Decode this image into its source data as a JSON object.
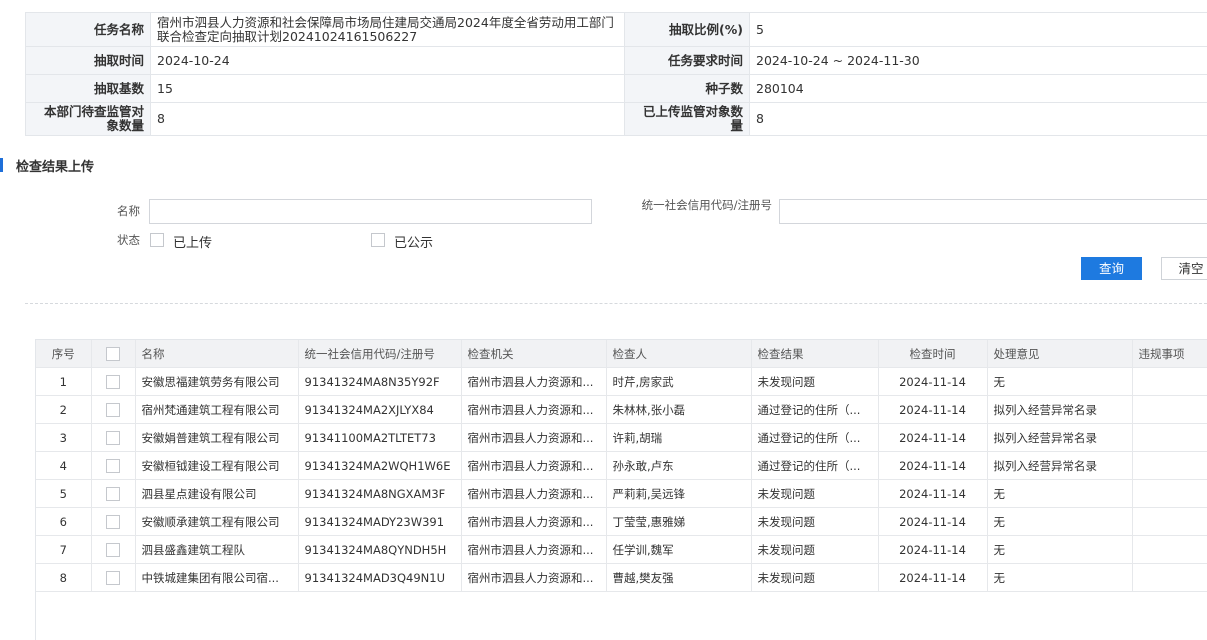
{
  "info": {
    "task_name_label": "任务名称",
    "task_name_value": "宿州市泗县人力资源和社会保障局市场局住建局交通局2024年度全省劳动用工部门联合检查定向抽取计划20241024161506227",
    "ratio_label": "抽取比例(%)",
    "ratio_value": "5",
    "draw_time_label": "抽取时间",
    "draw_time_value": "2024-10-24",
    "required_time_label": "任务要求时间",
    "required_time_value": "2024-10-24 ~ 2024-11-30",
    "base_label": "抽取基数",
    "base_value": "15",
    "seed_label": "种子数",
    "seed_value": "280104",
    "pending_label": "本部门待查监管对象数量",
    "pending_value": "8",
    "uploaded_label": "已上传监管对象数量",
    "uploaded_value": "8"
  },
  "section": {
    "title": "检查结果上传"
  },
  "filter": {
    "name_label": "名称",
    "name_value": "",
    "code_label": "统一社会信用代码/注册号",
    "code_value": "",
    "status_label": "状态",
    "status_options": [
      "已上传",
      "已公示"
    ],
    "query_button": "查询",
    "clear_button": "清空"
  },
  "grid": {
    "headers": [
      "序号",
      "",
      "名称",
      "统一社会信用代码/注册号",
      "检查机关",
      "检查人",
      "检查结果",
      "检查时间",
      "处理意见",
      "违规事项"
    ],
    "rows": [
      [
        "1",
        "安徽思福建筑劳务有限公司",
        "91341324MA8N35Y92F",
        "宿州市泗县人力资源和...",
        "时芹,房家武",
        "未发现问题",
        "2024-11-14",
        "无",
        ""
      ],
      [
        "2",
        "宿州梵通建筑工程有限公司",
        "91341324MA2XJLYX84",
        "宿州市泗县人力资源和...",
        "朱林林,张小磊",
        "通过登记的住所（...",
        "2024-11-14",
        "拟列入经营异常名录",
        ""
      ],
      [
        "3",
        "安徽娟普建筑工程有限公司",
        "91341100MA2TLTET73",
        "宿州市泗县人力资源和...",
        "许莉,胡瑞",
        "通过登记的住所（...",
        "2024-11-14",
        "拟列入经营异常名录",
        ""
      ],
      [
        "4",
        "安徽桓钺建设工程有限公司",
        "91341324MA2WQH1W6E",
        "宿州市泗县人力资源和...",
        "孙永敢,卢东",
        "通过登记的住所（...",
        "2024-11-14",
        "拟列入经营异常名录",
        ""
      ],
      [
        "5",
        "泗县星点建设有限公司",
        "91341324MA8NGXAM3F",
        "宿州市泗县人力资源和...",
        "严莉莉,吴远锋",
        "未发现问题",
        "2024-11-14",
        "无",
        ""
      ],
      [
        "6",
        "安徽顺承建筑工程有限公司",
        "91341324MADY23W391",
        "宿州市泗县人力资源和...",
        "丁莹莹,惠雅娣",
        "未发现问题",
        "2024-11-14",
        "无",
        ""
      ],
      [
        "7",
        "泗县盛鑫建筑工程队",
        "91341324MA8QYNDH5H",
        "宿州市泗县人力资源和...",
        "任学训,魏军",
        "未发现问题",
        "2024-11-14",
        "无",
        ""
      ],
      [
        "8",
        "中铁城建集团有限公司宿...",
        "91341324MAD3Q49N1U",
        "宿州市泗县人力资源和...",
        "曹越,樊友强",
        "未发现问题",
        "2024-11-14",
        "无",
        ""
      ]
    ]
  }
}
